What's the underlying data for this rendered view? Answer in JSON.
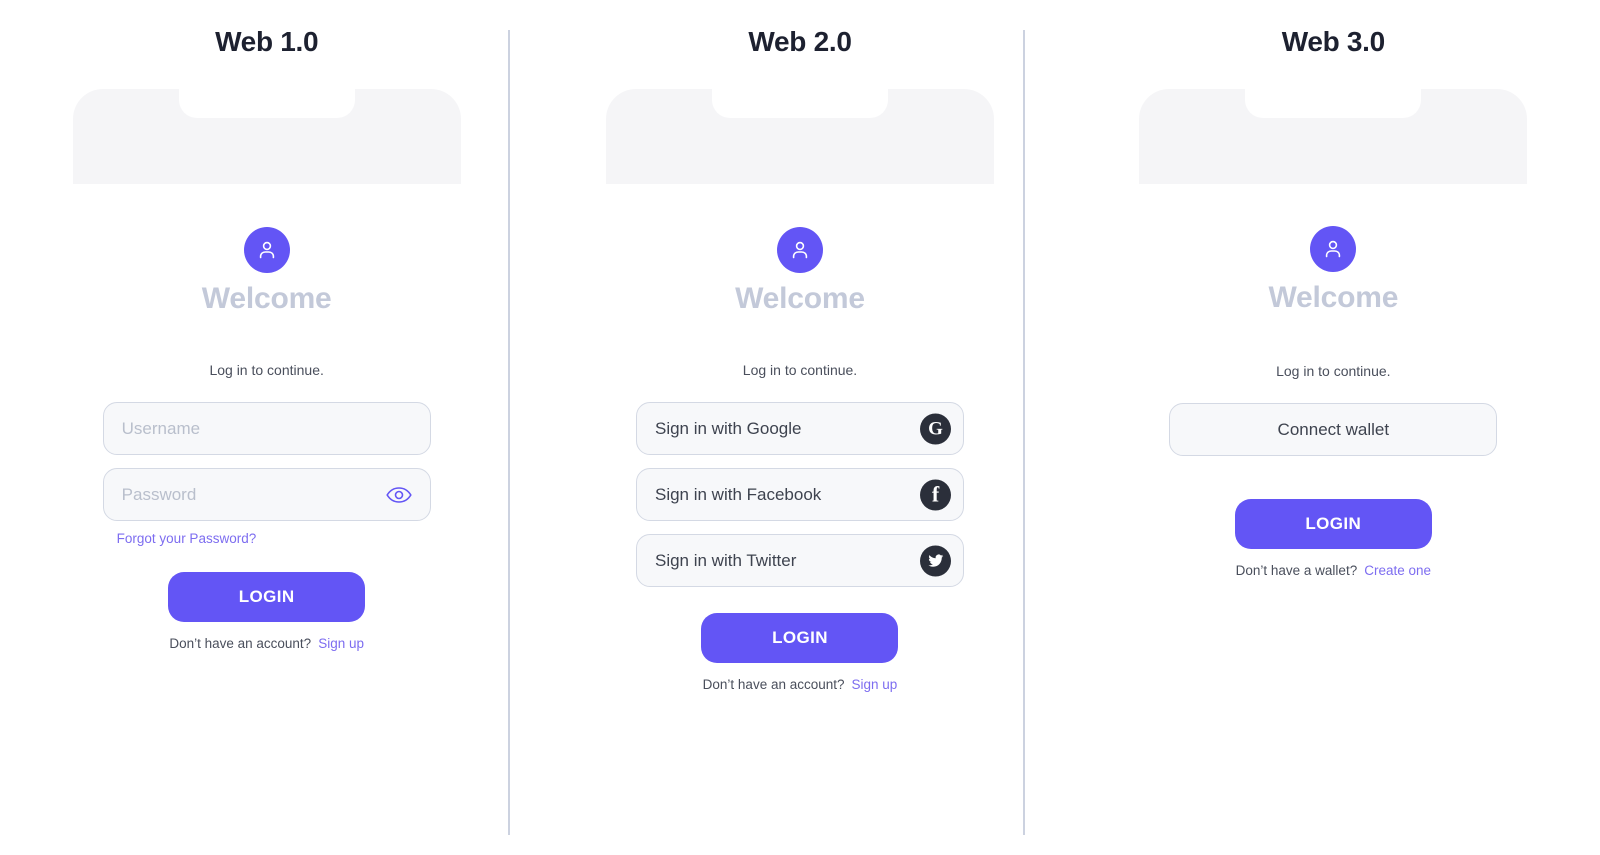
{
  "columns": [
    {
      "id": "web1",
      "title": "Web 1.0",
      "welcome": "Welcome",
      "subtitle": "Log in to continue.",
      "avatar_icon": "user-avatar-icon",
      "fields": [
        {
          "name": "username-input",
          "placeholder": "Username",
          "trailing_icon": null
        },
        {
          "name": "password-input",
          "placeholder": "Password",
          "trailing_icon": "eye-icon"
        }
      ],
      "forgot_link": "Forgot your Password?",
      "login_label": "LOGIN",
      "note_text": "Don’t have an account?",
      "note_link": "Sign up"
    },
    {
      "id": "web2",
      "title": "Web 2.0",
      "welcome": "Welcome",
      "subtitle": "Log in to continue.",
      "avatar_icon": "user-avatar-icon",
      "social_buttons": [
        {
          "name": "sign-in-google-button",
          "label": "Sign in with Google",
          "icon": "google-icon",
          "glyph": "G"
        },
        {
          "name": "sign-in-facebook-button",
          "label": "Sign in with Facebook",
          "icon": "facebook-icon",
          "glyph": "f"
        },
        {
          "name": "sign-in-twitter-button",
          "label": "Sign in with Twitter",
          "icon": "twitter-icon",
          "glyph": "bird"
        }
      ],
      "login_label": "LOGIN",
      "note_text": "Don’t have an account?",
      "note_link": "Sign up"
    },
    {
      "id": "web3",
      "title": "Web 3.0",
      "welcome": "Welcome",
      "subtitle": "Log in to continue.",
      "avatar_icon": "user-avatar-icon",
      "connect_label": "Connect wallet",
      "login_label": "LOGIN",
      "note_text": "Don’t have a wallet?",
      "note_link": "Create one"
    }
  ],
  "colors": {
    "accent": "#6355f5",
    "link": "#7d6df0",
    "welcome": "#c3c9d9",
    "title": "#1d2130",
    "social_badge": "#2b2f3a",
    "field_bg": "#f7f8fa",
    "field_border": "#d4d9e4",
    "phone_bg": "#f5f5f7",
    "divider": "#ccd2e0",
    "page_bg": "#ffffff"
  }
}
